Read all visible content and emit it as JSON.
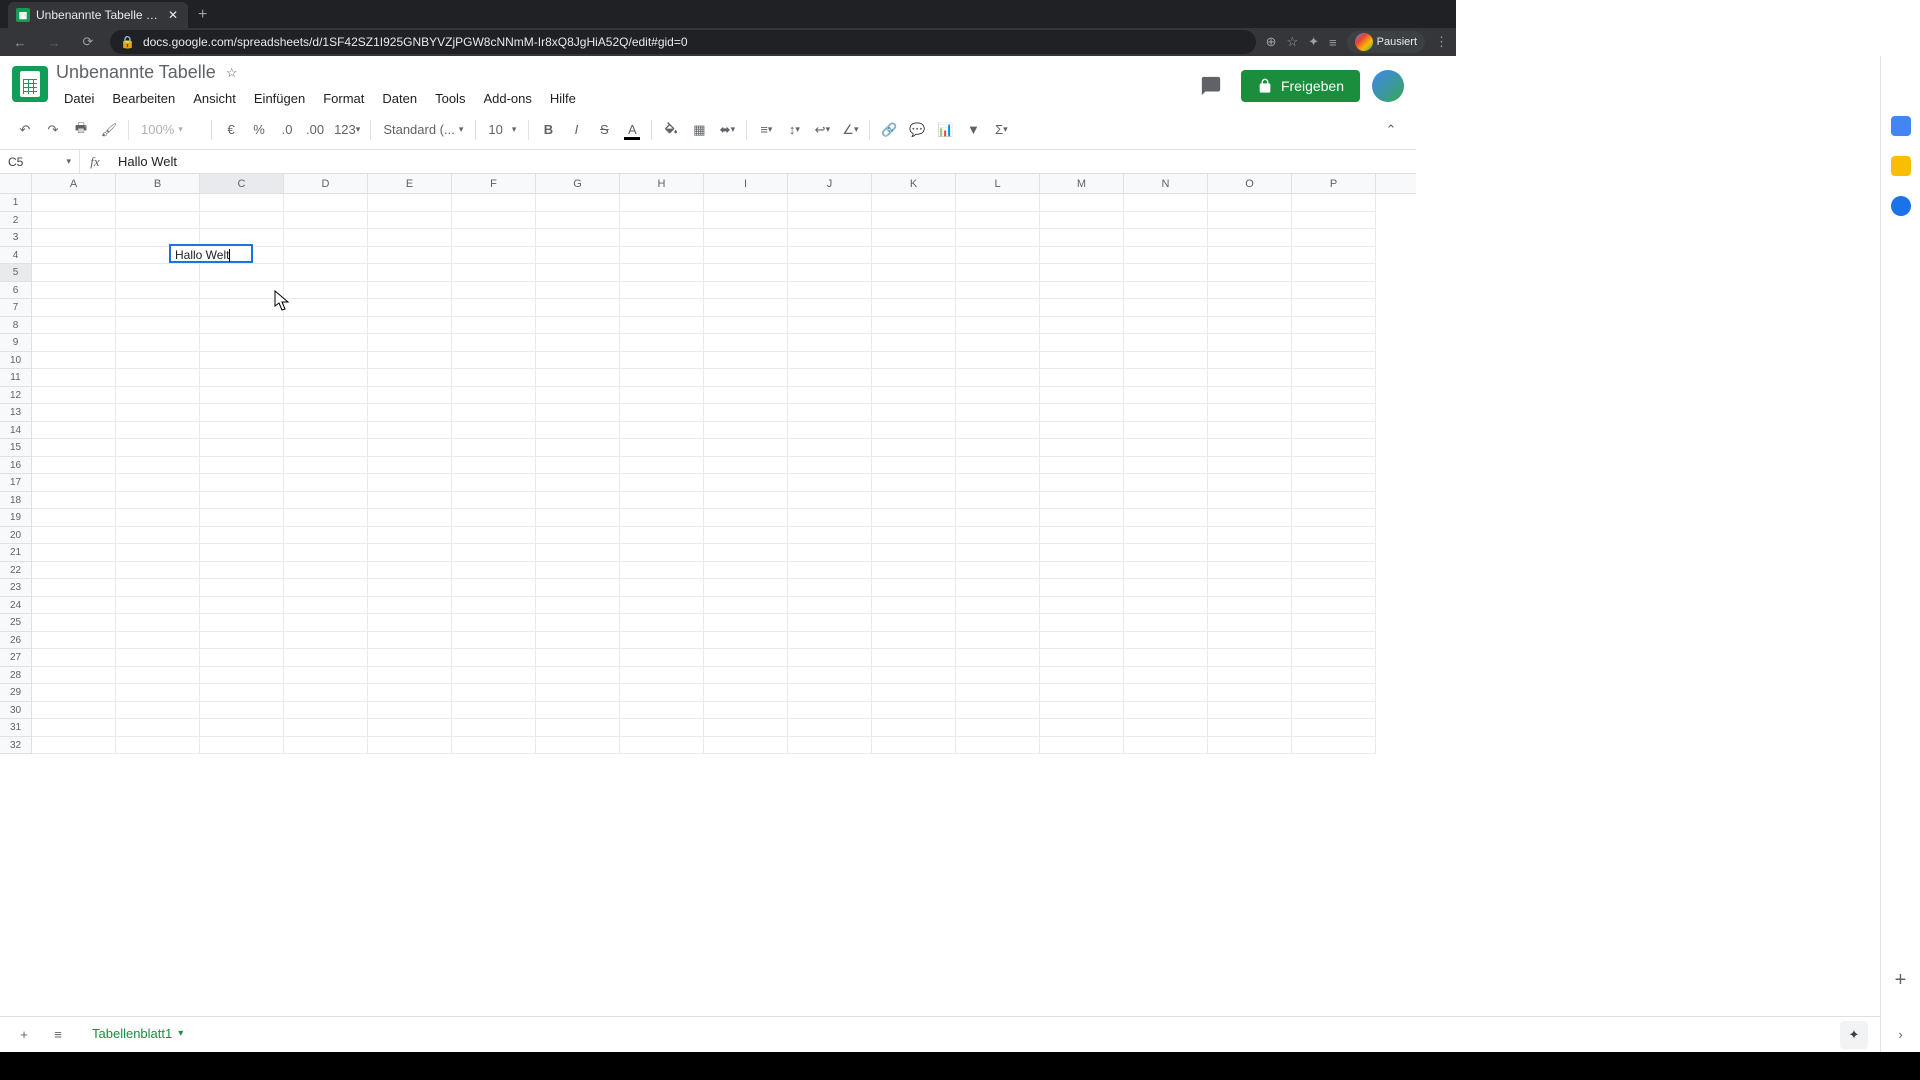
{
  "browser": {
    "tab_title": "Unbenannte Tabelle - Google Ta",
    "url": "docs.google.com/spreadsheets/d/1SF42SZ1I925GNBYVZjPGW8cNNmM-Ir8xQ8JgHiA52Q/edit#gid=0",
    "profile_status": "Pausiert"
  },
  "doc": {
    "title": "Unbenannte Tabelle",
    "menus": [
      "Datei",
      "Bearbeiten",
      "Ansicht",
      "Einfügen",
      "Format",
      "Daten",
      "Tools",
      "Add-ons",
      "Hilfe"
    ],
    "share_label": "Freigeben"
  },
  "toolbar": {
    "zoom": "100%",
    "currency": "€",
    "percent": "%",
    "dec_dec": ".0",
    "inc_dec": ".00",
    "more_formats": "123",
    "font": "Standard (...",
    "font_size": "10"
  },
  "cell_ref": "C5",
  "formula_value": "Hallo Welt",
  "active_cell_value": "Hallo Welt",
  "columns": [
    "A",
    "B",
    "C",
    "D",
    "E",
    "F",
    "G",
    "H",
    "I",
    "J",
    "K",
    "L",
    "M",
    "N",
    "O",
    "P"
  ],
  "rows": [
    1,
    2,
    3,
    4,
    5,
    6,
    7,
    8,
    9,
    10,
    11,
    12,
    13,
    14,
    15,
    16,
    17,
    18,
    19,
    20,
    21,
    22,
    23,
    24,
    25,
    26,
    27,
    28,
    29,
    30,
    31,
    32
  ],
  "selected_col": "C",
  "selected_row": 5,
  "sheet_tab": "Tabellenblatt1"
}
